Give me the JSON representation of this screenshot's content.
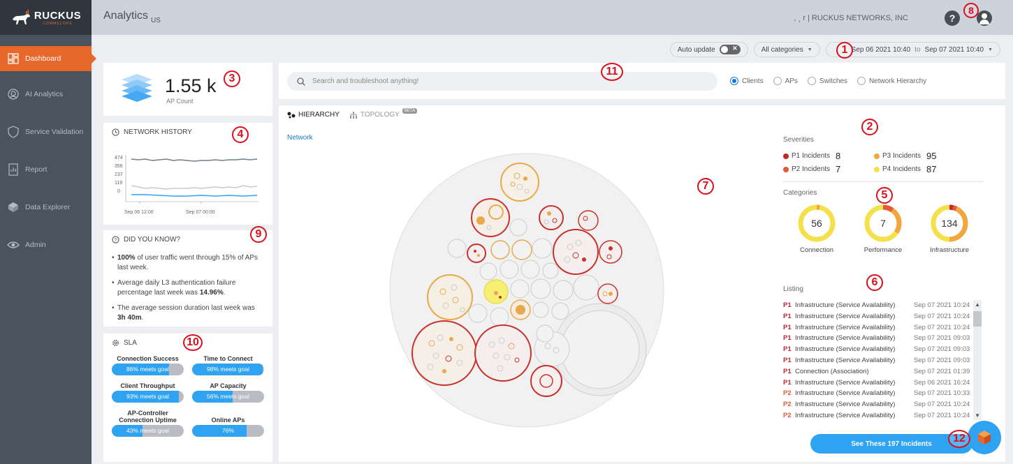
{
  "sidebar": {
    "logo": {
      "brand": "RUCKUS",
      "sub": "COMMSCOPE"
    },
    "items": [
      {
        "label": "Dashboard",
        "icon": "dashboard-icon",
        "active": true
      },
      {
        "label": "AI Analytics",
        "icon": "ai-analytics-icon"
      },
      {
        "label": "Service Validation",
        "icon": "service-validation-icon"
      },
      {
        "label": "Report",
        "icon": "report-icon"
      },
      {
        "label": "Data Explorer",
        "icon": "data-explorer-icon"
      },
      {
        "label": "Admin",
        "icon": "admin-icon"
      }
    ]
  },
  "header": {
    "title": "Analytics",
    "region": "US",
    "org": ", ¸ r | RUCKUS NETWORKS, INC",
    "help_label": "?"
  },
  "filters": {
    "auto_update": "Auto update",
    "categories": "All categories",
    "date_from": "Sep 06 2021 10:40",
    "date_to_word": "to",
    "date_to": "Sep 07 2021 10:40"
  },
  "annotations": [
    "1",
    "2",
    "3",
    "4",
    "5",
    "6",
    "7",
    "8",
    "9",
    "10",
    "11",
    "12"
  ],
  "ap_count": {
    "value": "1.55 k",
    "label": "AP Count"
  },
  "network_history": {
    "title": "NETWORK HISTORY",
    "y_ticks": [
      "474",
      "356",
      "237",
      "119",
      "0"
    ],
    "x_ticks": [
      "Sep 06 12:00",
      "Sep 07 00:00"
    ],
    "colors": {
      "aps": "#6e7f8d",
      "clients": "#c6c9cd",
      "incidents": "#2fa3f2"
    }
  },
  "did_you_know": {
    "title": "DID YOU KNOW?",
    "facts": [
      {
        "bold": "100%",
        "text": " of user traffic went through 15% of APs last week."
      },
      {
        "text": "Average daily L3 authentication failure percentage last week was ",
        "bold": "14.96%",
        "tail": "."
      },
      {
        "text": "The average session duration last week was ",
        "bold": "3h 40m",
        "tail": "."
      }
    ]
  },
  "sla": {
    "title": "SLA",
    "items": [
      {
        "name": "Connection Success",
        "text": "86% meets goal",
        "fill": 0.8
      },
      {
        "name": "Time to Connect",
        "text": "98% meets goal",
        "fill": 0.98
      },
      {
        "name": "Client Throughput",
        "text": "93% meets goal",
        "fill": 0.93
      },
      {
        "name": "AP Capacity",
        "text": "56% meets goal",
        "fill": 0.56
      },
      {
        "name": "AP-Controller Connection Uptime",
        "text": "43% meets goal",
        "fill": 0.43
      },
      {
        "name": "Online APs",
        "text": "76%",
        "fill": 0.76
      }
    ]
  },
  "search": {
    "placeholder": "Search and troubleshoot anything!",
    "options": [
      {
        "label": "Clients",
        "selected": true
      },
      {
        "label": "APs",
        "selected": false
      },
      {
        "label": "Switches",
        "selected": false
      },
      {
        "label": "Network Hierarchy",
        "selected": false
      }
    ]
  },
  "main": {
    "tabs": [
      {
        "label": "HIERARCHY",
        "active": true
      },
      {
        "label": "TOPOLOGY",
        "active": false,
        "badge": "BETA"
      }
    ],
    "breadcrumb": "Network"
  },
  "severities": {
    "title": "Severities",
    "items": [
      {
        "label": "P1 Incidents",
        "count": "8",
        "color": "#c3272b"
      },
      {
        "label": "P3 Incidents",
        "count": "95",
        "color": "#f2a640"
      },
      {
        "label": "P2 Incidents",
        "count": "7",
        "color": "#e25b38"
      },
      {
        "label": "P4 Incidents",
        "count": "87",
        "color": "#f4e04d"
      }
    ]
  },
  "categories": {
    "title": "Categories",
    "items": [
      {
        "label": "Connection",
        "count": "56"
      },
      {
        "label": "Performance",
        "count": "7"
      },
      {
        "label": "Infrastructure",
        "count": "134"
      }
    ]
  },
  "listing": {
    "title": "Listing",
    "rows": [
      {
        "p": "P1",
        "category": "Infrastructure (Service Availability)",
        "time": "Sep 07 2021 10:24"
      },
      {
        "p": "P1",
        "category": "Infrastructure (Service Availability)",
        "time": "Sep 07 2021 10:24"
      },
      {
        "p": "P1",
        "category": "Infrastructure (Service Availability)",
        "time": "Sep 07 2021 10:24"
      },
      {
        "p": "P1",
        "category": "Infrastructure (Service Availability)",
        "time": "Sep 07 2021 09:03"
      },
      {
        "p": "P1",
        "category": "Infrastructure (Service Availability)",
        "time": "Sep 07 2021 09:03"
      },
      {
        "p": "P1",
        "category": "Infrastructure (Service Availability)",
        "time": "Sep 07 2021 09:03"
      },
      {
        "p": "P1",
        "category": "Connection (Association)",
        "time": "Sep 07 2021 01:39"
      },
      {
        "p": "P1",
        "category": "Infrastructure (Service Availability)",
        "time": "Sep 06 2021 16:24"
      },
      {
        "p": "P2",
        "category": "Infrastructure (Service Availability)",
        "time": "Sep 07 2021 10:33"
      },
      {
        "p": "P2",
        "category": "Infrastructure (Service Availability)",
        "time": "Sep 07 2021 10:24"
      },
      {
        "p": "P2",
        "category": "Infrastructure (Service Availability)",
        "time": "Sep 07 2021 10:24"
      }
    ],
    "button": "See These 197 Incidents"
  }
}
